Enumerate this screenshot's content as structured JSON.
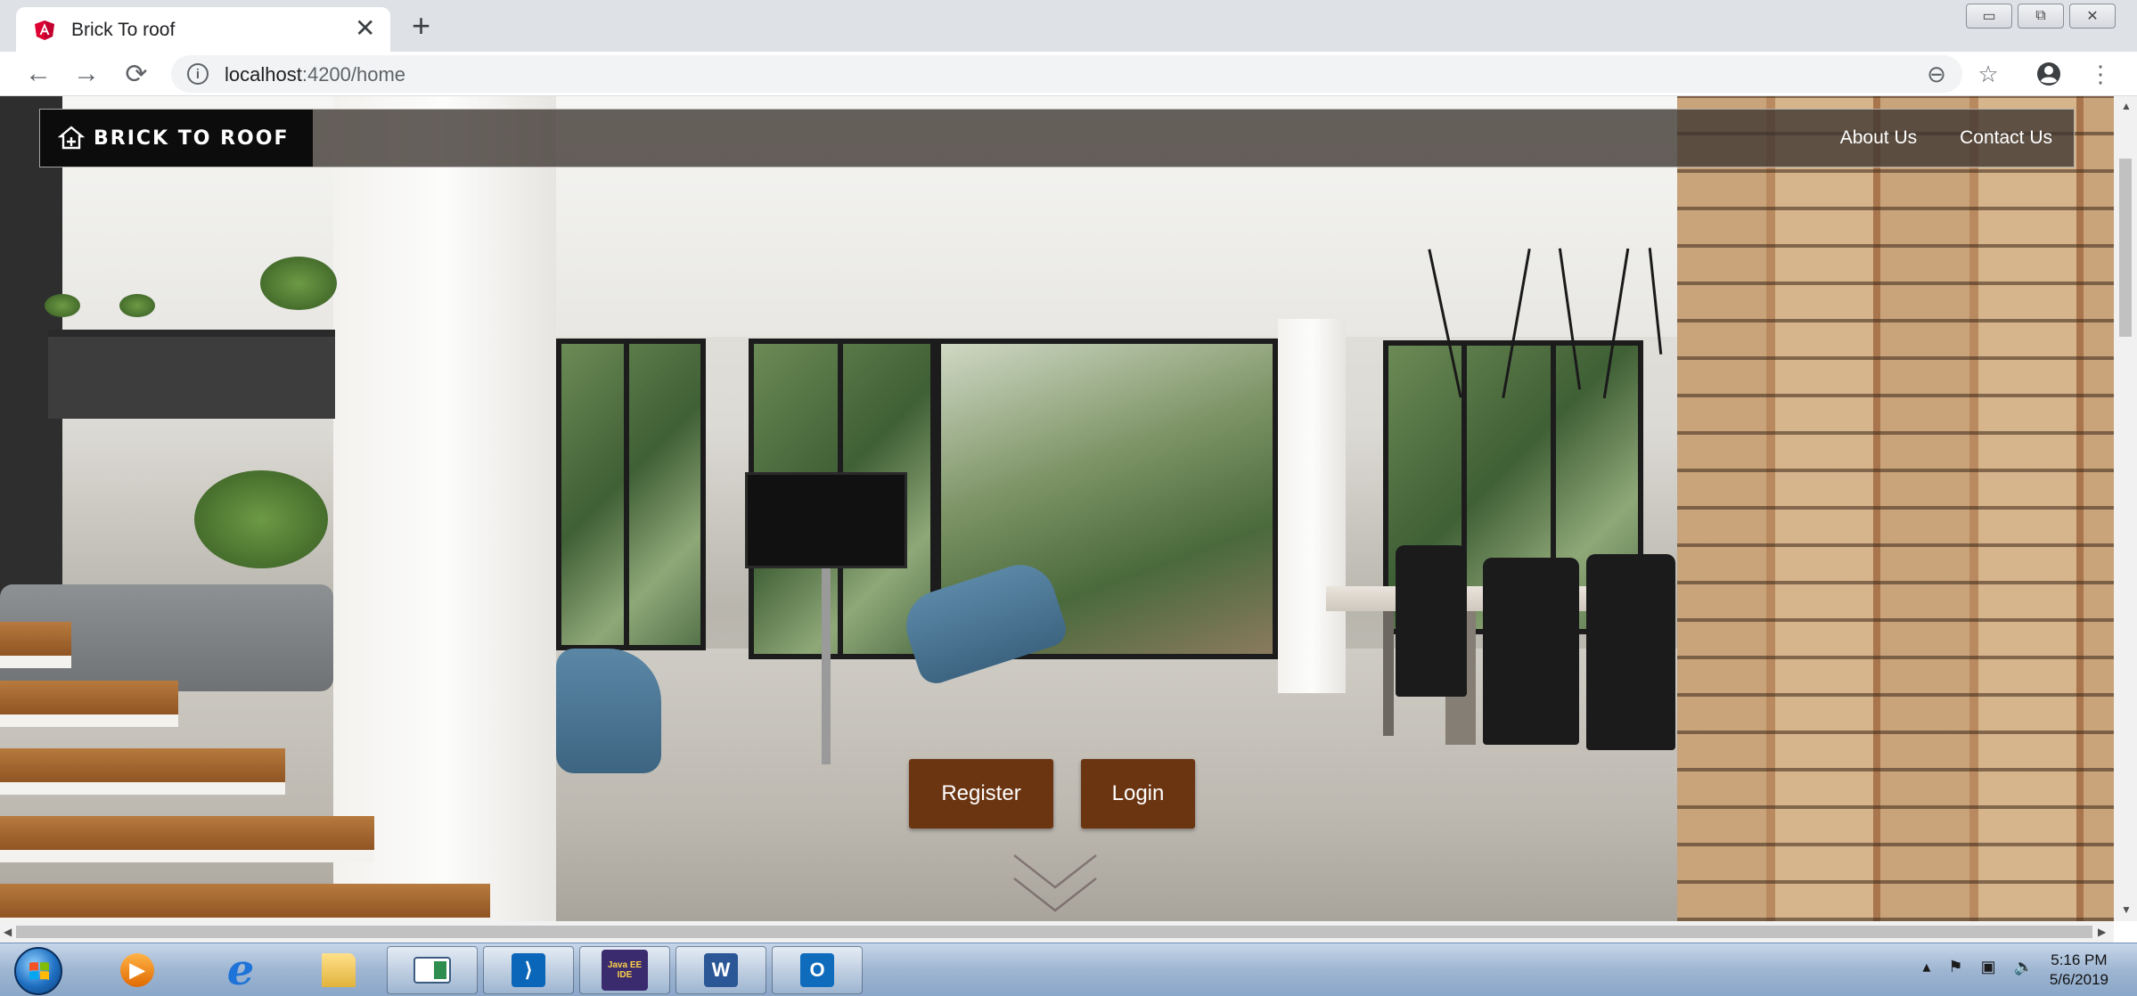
{
  "browser": {
    "tab_title": "Brick To roof",
    "tab_close": "✕",
    "new_tab": "+",
    "url_host": "localhost",
    "url_rest": ":4200/home",
    "window_buttons": [
      "▭",
      "⧉",
      "✕"
    ],
    "back_icon": "←",
    "forward_icon": "→",
    "reload_icon": "⟳",
    "zoom_icon": "⊖",
    "star_icon": "☆",
    "menu_icon": "⋮"
  },
  "site": {
    "brand": "BRICK TO ROOF",
    "nav_links": [
      "About Us",
      "Contact Us"
    ],
    "register_label": "Register",
    "login_label": "Login"
  },
  "taskbar": {
    "apps": [
      "media-player",
      "internet-explorer",
      "file-explorer",
      "window-app",
      "visual-studio-code",
      "java-ee-ide",
      "microsoft-word",
      "outlook"
    ],
    "java_label": "Java EE IDE",
    "word_label": "W",
    "outlook_label": "O",
    "vscode_label": "⟩",
    "ie_label": "e",
    "time": "5:16 PM",
    "date": "5/6/2019",
    "tray_icons": [
      "▴",
      "⚑",
      "▣",
      "🔈"
    ]
  },
  "colors": {
    "cta_brown": "#6b3512",
    "nav_overlay": "#3c3430",
    "brand_bg": "#0c0c0c"
  }
}
